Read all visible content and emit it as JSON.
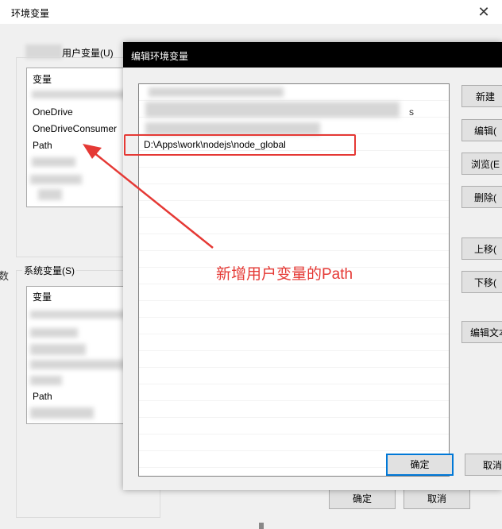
{
  "background_dialog": {
    "title": "环境变量",
    "close_glyph": "✕",
    "user_vars_label": "用户变量(U)",
    "user_list_header": "变量",
    "user_list_items": [
      "OneDrive",
      "OneDriveConsumer",
      "Path"
    ],
    "system_vars_label": "系统变量(S)",
    "system_list_header": "变量",
    "system_list_items": [
      "Path"
    ],
    "ok_label": "确定",
    "cancel_label": "取消",
    "edge_text": "",
    "edge_text_2": "数"
  },
  "edit_dialog": {
    "title": "编辑环境变量",
    "selected_entry": "D:\\Apps\\work\\nodejs\\node_global",
    "partial_entry_suffix": "s",
    "buttons": {
      "new": "新建",
      "edit": "编辑(",
      "browse": "浏览(E",
      "delete": "删除(",
      "move_up": "上移(",
      "move_down": "下移(",
      "edit_text": "编辑文本"
    },
    "ok_label": "确定",
    "cancel_label": "取消"
  },
  "annotation": {
    "text": "新增用户变量的Path",
    "color": "#e53935"
  },
  "colors": {
    "title_bar_active": "#000000",
    "highlight": "#e53935",
    "default_button_border": "#0078d7"
  }
}
